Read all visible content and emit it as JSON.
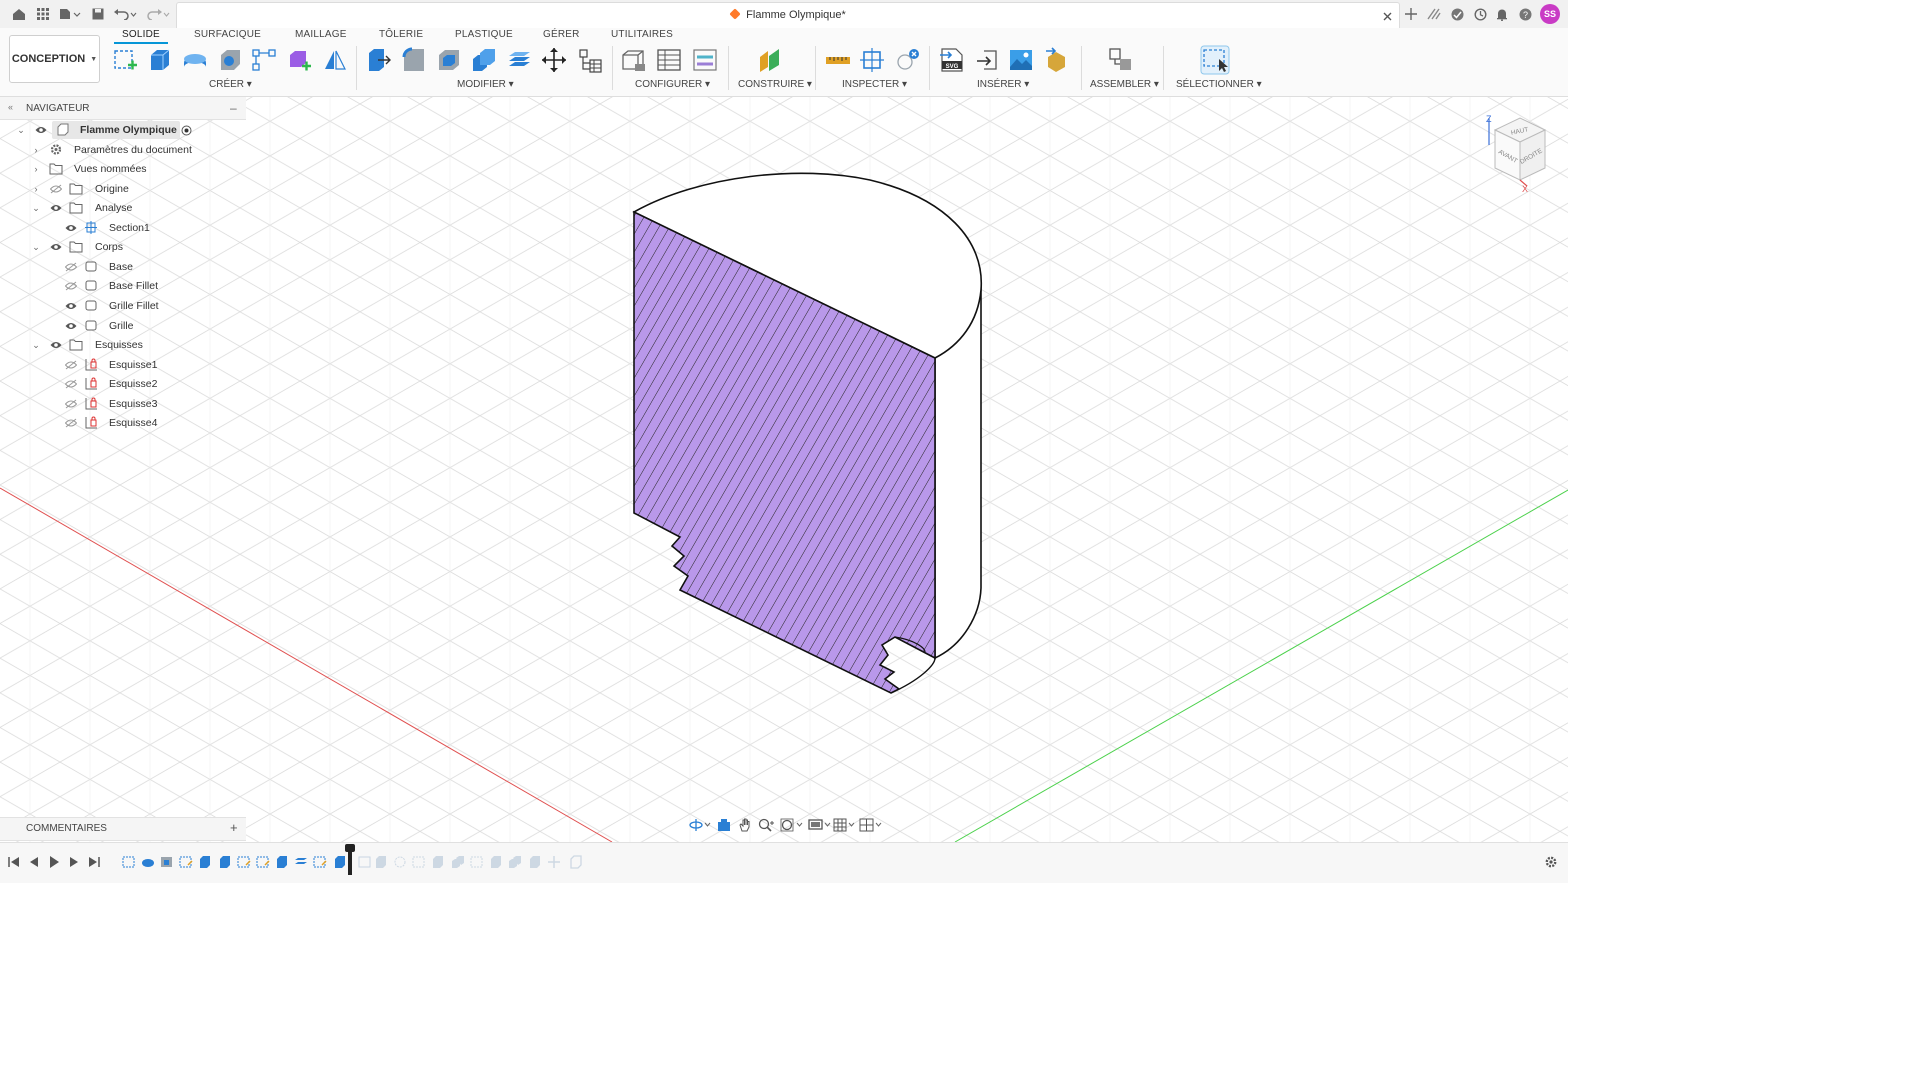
{
  "titlebar": {
    "document_title": "Flamme Olympique*",
    "user_initials": "SS"
  },
  "ribbon": {
    "workspace": "CONCEPTION",
    "tabs": [
      "SOLIDE",
      "SURFACIQUE",
      "MAILLAGE",
      "TÔLERIE",
      "PLASTIQUE",
      "GÉRER",
      "UTILITAIRES"
    ],
    "groups": [
      "CRÉER",
      "MODIFIER",
      "CONFIGURER",
      "CONSTRUIRE",
      "INSPECTER",
      "INSÉRER",
      "ASSEMBLER",
      "SÉLECTIONNER"
    ]
  },
  "navigator": {
    "title": "NAVIGATEUR",
    "items": [
      {
        "label": "Flamme Olympique"
      },
      {
        "label": "Paramètres du document"
      },
      {
        "label": "Vues nommées"
      },
      {
        "label": "Origine"
      },
      {
        "label": "Analyse"
      },
      {
        "label": "Section1"
      },
      {
        "label": "Corps"
      },
      {
        "label": "Base"
      },
      {
        "label": "Base Fillet"
      },
      {
        "label": "Grille Fillet"
      },
      {
        "label": "Grille"
      },
      {
        "label": "Esquisses"
      },
      {
        "label": "Esquisse1"
      },
      {
        "label": "Esquisse2"
      },
      {
        "label": "Esquisse3"
      },
      {
        "label": "Esquisse4"
      }
    ]
  },
  "comments": {
    "title": "COMMENTAIRES"
  },
  "viewcube": {
    "top": "HAUT",
    "front": "AVANT",
    "right": "DROITE",
    "axis_z": "Z",
    "axis_x": "X"
  },
  "colors": {
    "section_fill": "#b998ea",
    "accent": "#0696d7",
    "x_axis": "#e05050",
    "y_axis": "#4cd14c"
  }
}
